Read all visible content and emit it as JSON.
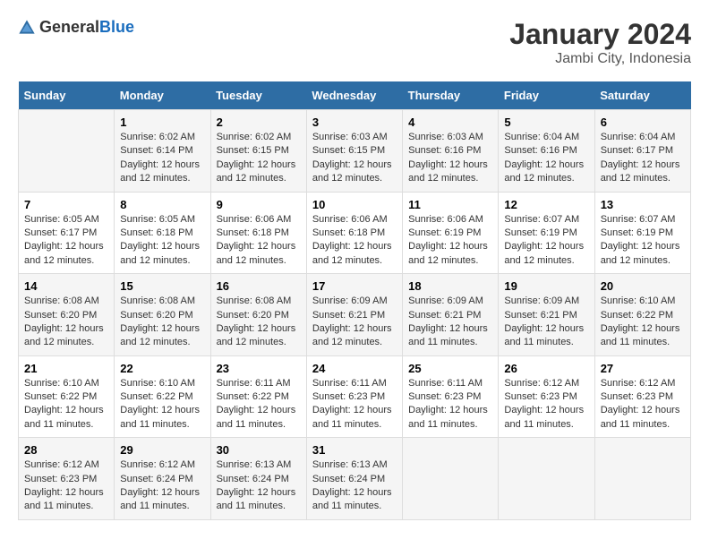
{
  "logo": {
    "text_general": "General",
    "text_blue": "Blue"
  },
  "title": "January 2024",
  "subtitle": "Jambi City, Indonesia",
  "days_header": [
    "Sunday",
    "Monday",
    "Tuesday",
    "Wednesday",
    "Thursday",
    "Friday",
    "Saturday"
  ],
  "weeks": [
    [
      {
        "day": "",
        "sunrise": "",
        "sunset": "",
        "daylight": ""
      },
      {
        "day": "1",
        "sunrise": "Sunrise: 6:02 AM",
        "sunset": "Sunset: 6:14 PM",
        "daylight": "Daylight: 12 hours and 12 minutes."
      },
      {
        "day": "2",
        "sunrise": "Sunrise: 6:02 AM",
        "sunset": "Sunset: 6:15 PM",
        "daylight": "Daylight: 12 hours and 12 minutes."
      },
      {
        "day": "3",
        "sunrise": "Sunrise: 6:03 AM",
        "sunset": "Sunset: 6:15 PM",
        "daylight": "Daylight: 12 hours and 12 minutes."
      },
      {
        "day": "4",
        "sunrise": "Sunrise: 6:03 AM",
        "sunset": "Sunset: 6:16 PM",
        "daylight": "Daylight: 12 hours and 12 minutes."
      },
      {
        "day": "5",
        "sunrise": "Sunrise: 6:04 AM",
        "sunset": "Sunset: 6:16 PM",
        "daylight": "Daylight: 12 hours and 12 minutes."
      },
      {
        "day": "6",
        "sunrise": "Sunrise: 6:04 AM",
        "sunset": "Sunset: 6:17 PM",
        "daylight": "Daylight: 12 hours and 12 minutes."
      }
    ],
    [
      {
        "day": "7",
        "sunrise": "Sunrise: 6:05 AM",
        "sunset": "Sunset: 6:17 PM",
        "daylight": "Daylight: 12 hours and 12 minutes."
      },
      {
        "day": "8",
        "sunrise": "Sunrise: 6:05 AM",
        "sunset": "Sunset: 6:18 PM",
        "daylight": "Daylight: 12 hours and 12 minutes."
      },
      {
        "day": "9",
        "sunrise": "Sunrise: 6:06 AM",
        "sunset": "Sunset: 6:18 PM",
        "daylight": "Daylight: 12 hours and 12 minutes."
      },
      {
        "day": "10",
        "sunrise": "Sunrise: 6:06 AM",
        "sunset": "Sunset: 6:18 PM",
        "daylight": "Daylight: 12 hours and 12 minutes."
      },
      {
        "day": "11",
        "sunrise": "Sunrise: 6:06 AM",
        "sunset": "Sunset: 6:19 PM",
        "daylight": "Daylight: 12 hours and 12 minutes."
      },
      {
        "day": "12",
        "sunrise": "Sunrise: 6:07 AM",
        "sunset": "Sunset: 6:19 PM",
        "daylight": "Daylight: 12 hours and 12 minutes."
      },
      {
        "day": "13",
        "sunrise": "Sunrise: 6:07 AM",
        "sunset": "Sunset: 6:19 PM",
        "daylight": "Daylight: 12 hours and 12 minutes."
      }
    ],
    [
      {
        "day": "14",
        "sunrise": "Sunrise: 6:08 AM",
        "sunset": "Sunset: 6:20 PM",
        "daylight": "Daylight: 12 hours and 12 minutes."
      },
      {
        "day": "15",
        "sunrise": "Sunrise: 6:08 AM",
        "sunset": "Sunset: 6:20 PM",
        "daylight": "Daylight: 12 hours and 12 minutes."
      },
      {
        "day": "16",
        "sunrise": "Sunrise: 6:08 AM",
        "sunset": "Sunset: 6:20 PM",
        "daylight": "Daylight: 12 hours and 12 minutes."
      },
      {
        "day": "17",
        "sunrise": "Sunrise: 6:09 AM",
        "sunset": "Sunset: 6:21 PM",
        "daylight": "Daylight: 12 hours and 12 minutes."
      },
      {
        "day": "18",
        "sunrise": "Sunrise: 6:09 AM",
        "sunset": "Sunset: 6:21 PM",
        "daylight": "Daylight: 12 hours and 11 minutes."
      },
      {
        "day": "19",
        "sunrise": "Sunrise: 6:09 AM",
        "sunset": "Sunset: 6:21 PM",
        "daylight": "Daylight: 12 hours and 11 minutes."
      },
      {
        "day": "20",
        "sunrise": "Sunrise: 6:10 AM",
        "sunset": "Sunset: 6:22 PM",
        "daylight": "Daylight: 12 hours and 11 minutes."
      }
    ],
    [
      {
        "day": "21",
        "sunrise": "Sunrise: 6:10 AM",
        "sunset": "Sunset: 6:22 PM",
        "daylight": "Daylight: 12 hours and 11 minutes."
      },
      {
        "day": "22",
        "sunrise": "Sunrise: 6:10 AM",
        "sunset": "Sunset: 6:22 PM",
        "daylight": "Daylight: 12 hours and 11 minutes."
      },
      {
        "day": "23",
        "sunrise": "Sunrise: 6:11 AM",
        "sunset": "Sunset: 6:22 PM",
        "daylight": "Daylight: 12 hours and 11 minutes."
      },
      {
        "day": "24",
        "sunrise": "Sunrise: 6:11 AM",
        "sunset": "Sunset: 6:23 PM",
        "daylight": "Daylight: 12 hours and 11 minutes."
      },
      {
        "day": "25",
        "sunrise": "Sunrise: 6:11 AM",
        "sunset": "Sunset: 6:23 PM",
        "daylight": "Daylight: 12 hours and 11 minutes."
      },
      {
        "day": "26",
        "sunrise": "Sunrise: 6:12 AM",
        "sunset": "Sunset: 6:23 PM",
        "daylight": "Daylight: 12 hours and 11 minutes."
      },
      {
        "day": "27",
        "sunrise": "Sunrise: 6:12 AM",
        "sunset": "Sunset: 6:23 PM",
        "daylight": "Daylight: 12 hours and 11 minutes."
      }
    ],
    [
      {
        "day": "28",
        "sunrise": "Sunrise: 6:12 AM",
        "sunset": "Sunset: 6:23 PM",
        "daylight": "Daylight: 12 hours and 11 minutes."
      },
      {
        "day": "29",
        "sunrise": "Sunrise: 6:12 AM",
        "sunset": "Sunset: 6:24 PM",
        "daylight": "Daylight: 12 hours and 11 minutes."
      },
      {
        "day": "30",
        "sunrise": "Sunrise: 6:13 AM",
        "sunset": "Sunset: 6:24 PM",
        "daylight": "Daylight: 12 hours and 11 minutes."
      },
      {
        "day": "31",
        "sunrise": "Sunrise: 6:13 AM",
        "sunset": "Sunset: 6:24 PM",
        "daylight": "Daylight: 12 hours and 11 minutes."
      },
      {
        "day": "",
        "sunrise": "",
        "sunset": "",
        "daylight": ""
      },
      {
        "day": "",
        "sunrise": "",
        "sunset": "",
        "daylight": ""
      },
      {
        "day": "",
        "sunrise": "",
        "sunset": "",
        "daylight": ""
      }
    ]
  ]
}
